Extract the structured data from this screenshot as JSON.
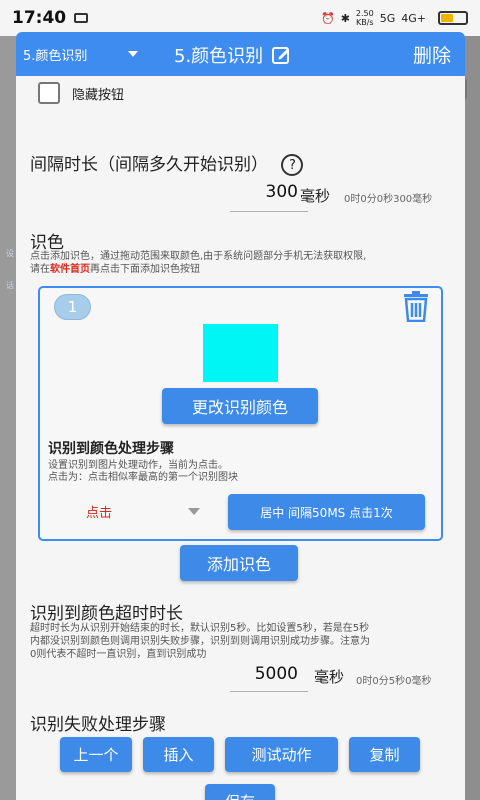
{
  "status_bar": {
    "time": "17:40",
    "net_speed": "2.50",
    "net_unit": "KB/s",
    "signal_1": "5G",
    "signal_2": "4G+"
  },
  "background": {
    "left_text_1": "设",
    "left_text_2": "话"
  },
  "header": {
    "selected_item": "5.颜色识别",
    "title": "5.颜色识别",
    "delete_label": "删除",
    "bg_color": "#3f8cf0"
  },
  "hide_button": {
    "label": "隐藏按钮",
    "checked": false
  },
  "interval": {
    "title": "间隔时长（间隔多久开始识别）",
    "help": "?",
    "value": "300",
    "unit": "毫秒",
    "duration_text": "0时0分0秒300毫秒"
  },
  "color_section": {
    "title": "识色",
    "desc_line1": "点击添加识色，通过拖动范围来取颜色,由于系统问题部分手机无法获取权限,",
    "desc_line2_pre": "请在",
    "desc_line2_link": "软件首页",
    "desc_line2_post": "再点击下面添加识色按钮"
  },
  "color_card": {
    "index": "1",
    "swatch_color": "#00f5f5",
    "change_button": "更改识别颜色",
    "steps_title": "识别到颜色处理步骤",
    "steps_desc_1": "设置识别到图片处理动作，当前为点击。",
    "steps_desc_2": "点击为：点击相似率最高的第一个识别图块",
    "action_selected": "点击",
    "action_detail_button": "居中 间隔50MS 点击1次"
  },
  "add_color_button": "添加识色",
  "timeout": {
    "title": "识别到颜色超时时长",
    "desc_line1": "超时时长为从识别开始结束的时长，默认识别5秒。比如设置5秒，若是在5秒",
    "desc_line2": "内都没识别到颜色则调用识别失败步骤，识别到则调用识别成功步骤。注意为",
    "desc_line3": "0则代表不超时一直识别，直到识别成功",
    "value": "5000",
    "unit": "毫秒",
    "duration_text": "0时0分5秒0毫秒"
  },
  "fail_steps": {
    "title": "识别失败处理步骤"
  },
  "bottom_buttons": {
    "prev": "上一个",
    "insert": "插入",
    "test": "测试动作",
    "copy": "复制",
    "save": "保存"
  },
  "colors": {
    "accent": "#3d8ae8",
    "link_red": "#d9281c"
  }
}
